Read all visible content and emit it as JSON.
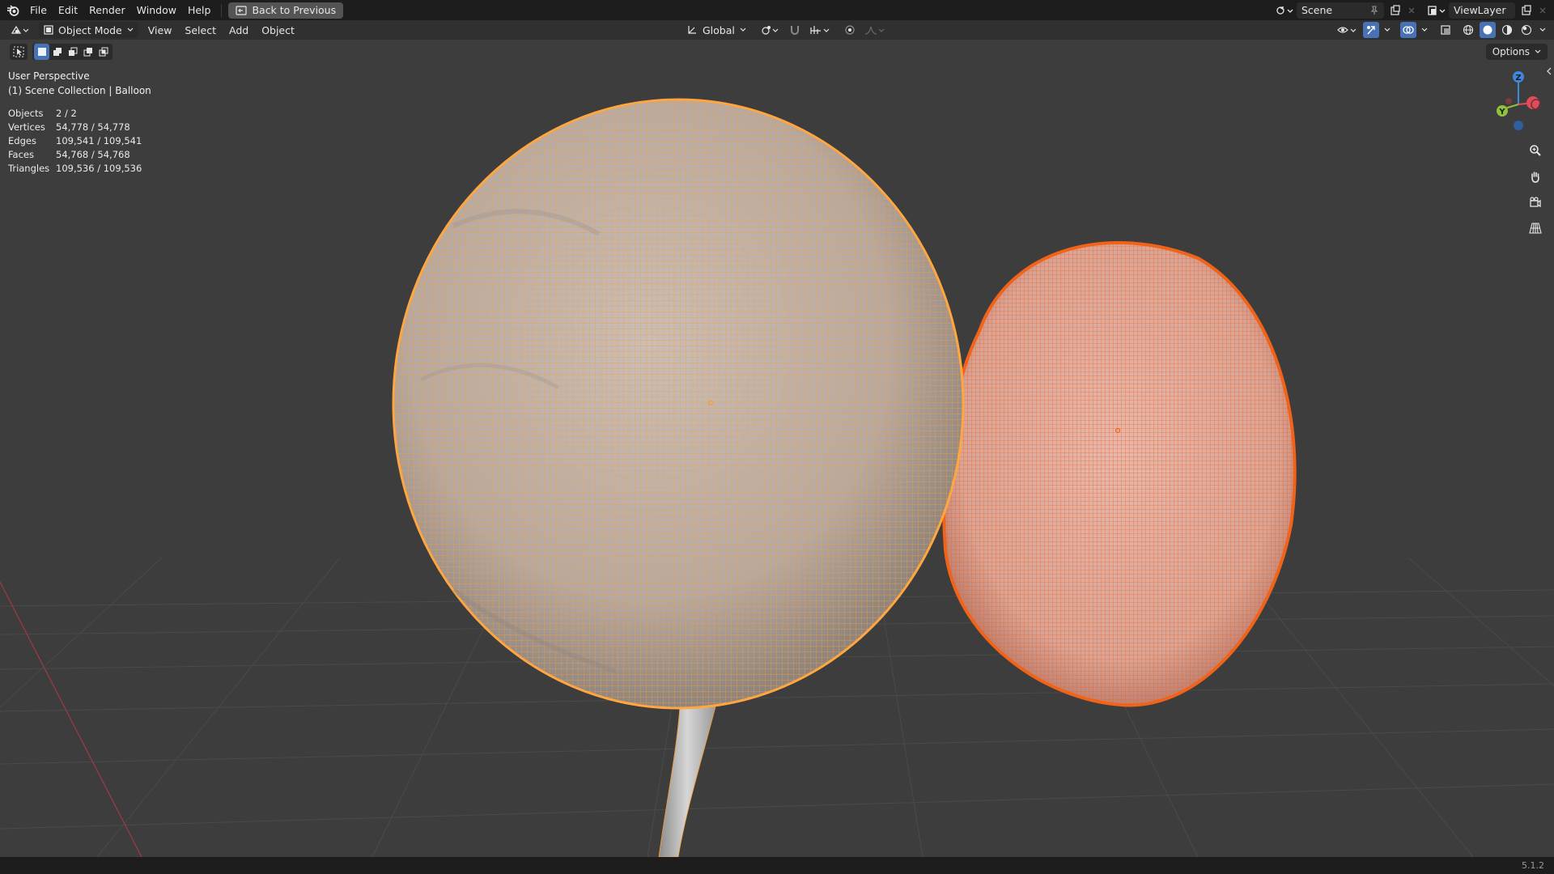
{
  "app": {
    "menu": [
      "File",
      "Edit",
      "Render",
      "Window",
      "Help"
    ],
    "back_button": "Back to Previous",
    "scene_name": "Scene",
    "view_layer": "ViewLayer"
  },
  "header": {
    "mode": "Object Mode",
    "menus": [
      "View",
      "Select",
      "Add",
      "Object"
    ],
    "transform_orientation": "Global"
  },
  "viewport": {
    "view_name": "User Perspective",
    "collection_line": "(1) Scene Collection | Balloon",
    "options_label": "Options",
    "stats": [
      {
        "label": "Objects",
        "value": "2 / 2"
      },
      {
        "label": "Vertices",
        "value": "54,778 / 54,778"
      },
      {
        "label": "Edges",
        "value": "109,541 / 109,541"
      },
      {
        "label": "Faces",
        "value": "54,768 / 54,768"
      },
      {
        "label": "Triangles",
        "value": "109,536 / 109,536"
      }
    ],
    "gizmo_axes": {
      "z": "Z",
      "y": "Y"
    }
  },
  "status": {
    "version": "5.1.2"
  },
  "colors": {
    "active_wire": "#ff9a2e",
    "selected_wire": "#f2631a",
    "ui_accent": "#4772b3",
    "axis_x": "#e24b5a",
    "axis_y": "#8fc13d",
    "axis_z": "#3f87e0"
  }
}
